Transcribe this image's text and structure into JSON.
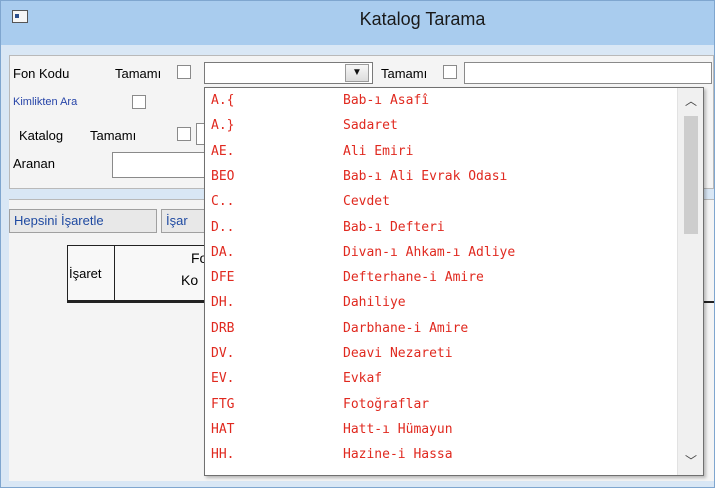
{
  "window": {
    "title": "Katalog Tarama"
  },
  "form": {
    "fon_kodu_label": "Fon Kodu",
    "tamami_1": "Tamamı",
    "tamami_2": "Tamamı",
    "kimlikten_ara_label": "Kimlikten Ara",
    "katalog_label": "Katalog",
    "tamami_3": "Tamamı",
    "aranan_label": "Aranan"
  },
  "toolbar": {
    "select_all_label": "Hepsini İşaretle",
    "second_button_label": "İşar"
  },
  "grid": {
    "col_isaret": "İşaret",
    "col_fon_top": "Fo",
    "col_fon_bottom": "Ko"
  },
  "dropdown": {
    "items": [
      {
        "code": "A.{",
        "name": "Bab-ı Asafî"
      },
      {
        "code": "A.}",
        "name": "Sadaret"
      },
      {
        "code": "AE.",
        "name": "Ali Emiri"
      },
      {
        "code": "BEO",
        "name": "Bab-ı Ali Evrak Odası"
      },
      {
        "code": "C..",
        "name": "Cevdet"
      },
      {
        "code": "D..",
        "name": "Bab-ı Defteri"
      },
      {
        "code": "DA.",
        "name": "Divan-ı Ahkam-ı Adliye"
      },
      {
        "code": "DFE",
        "name": "Defterhane-i Amire"
      },
      {
        "code": "DH.",
        "name": "Dahiliye"
      },
      {
        "code": "DRB",
        "name": "Darbhane-i Amire"
      },
      {
        "code": "DV.",
        "name": "Deavi Nezareti"
      },
      {
        "code": "EV.",
        "name": "Evkaf"
      },
      {
        "code": "FTG",
        "name": "Fotoğraflar"
      },
      {
        "code": "HAT",
        "name": "Hatt-ı Hümayun"
      },
      {
        "code": "HH.",
        "name": "Hazine-i Hassa"
      }
    ]
  },
  "colors": {
    "item_text": "#e0291f",
    "link_text": "#1f4aa1",
    "titlebar": "#a9ccee"
  },
  "icons": {
    "window_icon": "app-window-icon",
    "combo_arrow": "chevron-down-icon",
    "scroll_up": "chevron-up-icon",
    "scroll_down": "chevron-down-icon"
  }
}
